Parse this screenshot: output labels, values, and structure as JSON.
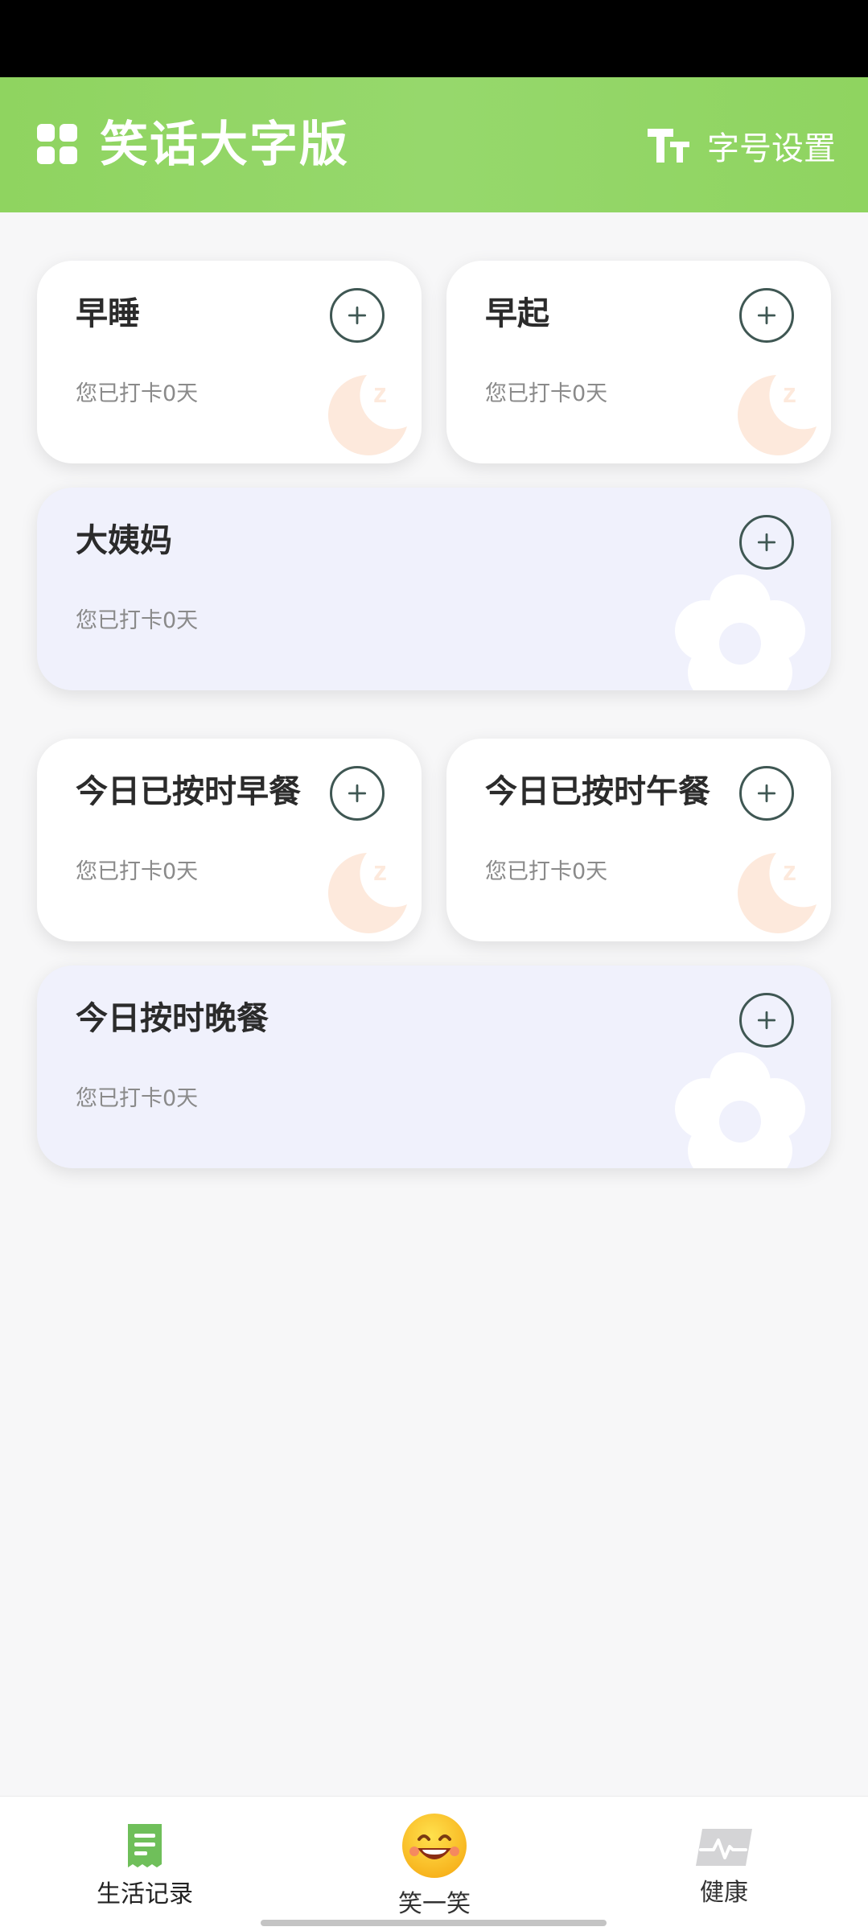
{
  "header": {
    "title": "笑话大字版",
    "font_setting_label": "字号设置"
  },
  "cards": [
    {
      "title": "早睡",
      "subtitle": "您已打卡0天"
    },
    {
      "title": "早起",
      "subtitle": "您已打卡0天"
    },
    {
      "title": "大姨妈",
      "subtitle": "您已打卡0天"
    },
    {
      "title": "今日已按时早餐",
      "subtitle": "您已打卡0天"
    },
    {
      "title": "今日已按时午餐",
      "subtitle": "您已打卡0天"
    },
    {
      "title": "今日按时晚餐",
      "subtitle": "您已打卡0天"
    }
  ],
  "bottom_nav": {
    "items": [
      {
        "label": "生活记录",
        "icon": "receipt-icon",
        "active": true
      },
      {
        "label": "笑一笑",
        "icon": "smiley-emoji-icon",
        "active": false
      },
      {
        "label": "健康",
        "icon": "heartbeat-icon",
        "active": false
      }
    ]
  },
  "colors": {
    "header": "#8fd460",
    "accent_green": "#6fbf5a",
    "lavender_card": "#f0f1fc",
    "add_button": "#3f5753",
    "moon_deco": "#fde9dc"
  }
}
